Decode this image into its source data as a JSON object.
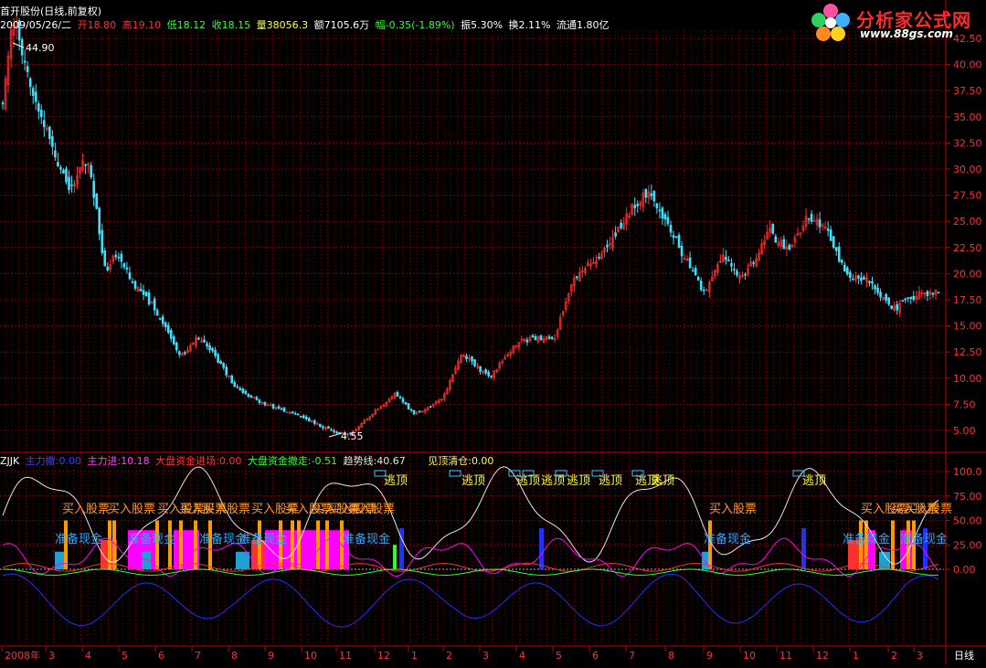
{
  "header": {
    "title": "首开股份(日线,前复权)",
    "date": "2009/05/26/二",
    "open": "开18.80",
    "high": "高19.10",
    "low": "低18.12",
    "close": "收18.15",
    "volume": "量38056.3",
    "amount": "额7105.6万",
    "change": "幅-0.35(-1.89%)",
    "amplitude": "振5.30%",
    "turnover": "换2.11%",
    "float": "流通1.80亿"
  },
  "logo": {
    "text": "分析家公式网",
    "url": "www.88gs.com"
  },
  "colors": {
    "up": "#ff3030",
    "down": "#40e0ff",
    "grid": "#7a0000",
    "border": "#c00000",
    "axis_text": "#ff3030",
    "magenta": "#ff00ff",
    "orange": "#ff9900",
    "cyan_bar": "#1fa0d0",
    "white": "#e8e8e8",
    "blue": "#2030ff",
    "green": "#30ff30"
  },
  "indicator": {
    "name": "ZJJK",
    "fields": [
      {
        "label": "主力撤:0.00",
        "color": "#4040ff"
      },
      {
        "label": "主力进:10.18",
        "color": "#ff40ff"
      },
      {
        "label": "大盘资金进场:0.00",
        "color": "#ff3030"
      },
      {
        "label": "大盘资金撤走:-0.51",
        "color": "#30ff30"
      },
      {
        "label": "趋势线:40.67",
        "color": "#e8e8e8"
      },
      {
        "label": "见顶清仓:0.00",
        "color": "#ffff60"
      }
    ],
    "signals": {
      "buy": "买入股票",
      "escape": "逃顶",
      "prepare": "准备现金"
    }
  },
  "price_axis": {
    "ticks": [
      "42.50",
      "40.00",
      "37.50",
      "35.00",
      "32.50",
      "30.00",
      "27.50",
      "25.00",
      "22.50",
      "20.00",
      "17.50",
      "15.00",
      "12.50",
      "10.00",
      "7.50",
      "5.00"
    ],
    "max_label": "44.90",
    "min_label": "4.55"
  },
  "ind_axis": {
    "ticks": [
      "100.0",
      "75.00",
      "50.00",
      "25.00",
      "0.00"
    ]
  },
  "time_axis": {
    "labels": [
      "2008年",
      "3",
      "4",
      "5",
      "6",
      "7",
      "8",
      "9",
      "10",
      "11",
      "12",
      "1",
      "2",
      "3",
      "4",
      "5",
      "6",
      "7",
      "8",
      "9",
      "10",
      "11",
      "12",
      "1",
      "2",
      "3"
    ],
    "period": "日线"
  },
  "chart_data": {
    "type": "candlestick",
    "title": "首开股份(日线,前复权)",
    "y_range": [
      3.5,
      46
    ],
    "price_path": [
      {
        "t": 0.0,
        "p": 36
      },
      {
        "t": 0.01,
        "p": 44.9
      },
      {
        "t": 0.03,
        "p": 38
      },
      {
        "t": 0.05,
        "p": 33
      },
      {
        "t": 0.07,
        "p": 28
      },
      {
        "t": 0.09,
        "p": 31
      },
      {
        "t": 0.1,
        "p": 26
      },
      {
        "t": 0.11,
        "p": 20
      },
      {
        "t": 0.12,
        "p": 22
      },
      {
        "t": 0.14,
        "p": 19
      },
      {
        "t": 0.16,
        "p": 17
      },
      {
        "t": 0.18,
        "p": 14
      },
      {
        "t": 0.19,
        "p": 12
      },
      {
        "t": 0.21,
        "p": 14
      },
      {
        "t": 0.22,
        "p": 13
      },
      {
        "t": 0.25,
        "p": 9
      },
      {
        "t": 0.28,
        "p": 7.5
      },
      {
        "t": 0.32,
        "p": 6.3
      },
      {
        "t": 0.35,
        "p": 5
      },
      {
        "t": 0.37,
        "p": 4.55
      },
      {
        "t": 0.4,
        "p": 7
      },
      {
        "t": 0.42,
        "p": 8.5
      },
      {
        "t": 0.44,
        "p": 6.5
      },
      {
        "t": 0.47,
        "p": 8
      },
      {
        "t": 0.49,
        "p": 12.5
      },
      {
        "t": 0.52,
        "p": 10
      },
      {
        "t": 0.55,
        "p": 13.5
      },
      {
        "t": 0.59,
        "p": 14
      },
      {
        "t": 0.61,
        "p": 19.5
      },
      {
        "t": 0.64,
        "p": 22
      },
      {
        "t": 0.67,
        "p": 26
      },
      {
        "t": 0.69,
        "p": 28
      },
      {
        "t": 0.72,
        "p": 23
      },
      {
        "t": 0.75,
        "p": 18
      },
      {
        "t": 0.77,
        "p": 22
      },
      {
        "t": 0.79,
        "p": 19.5
      },
      {
        "t": 0.82,
        "p": 24
      },
      {
        "t": 0.84,
        "p": 22
      },
      {
        "t": 0.86,
        "p": 25.5
      },
      {
        "t": 0.88,
        "p": 24.5
      },
      {
        "t": 0.9,
        "p": 20
      },
      {
        "t": 0.93,
        "p": 19
      },
      {
        "t": 0.95,
        "p": 16.5
      },
      {
        "t": 0.98,
        "p": 18
      },
      {
        "t": 1.0,
        "p": 18.15
      }
    ]
  }
}
